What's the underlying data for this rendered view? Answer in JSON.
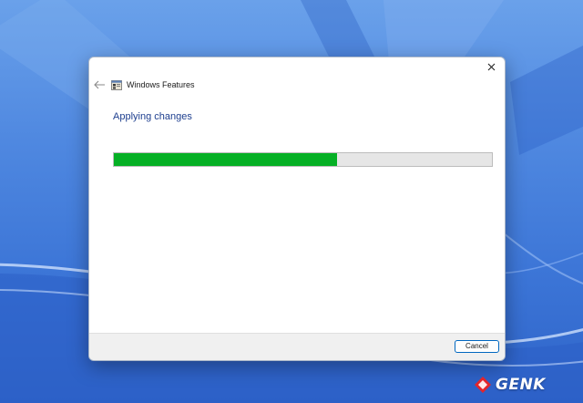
{
  "window": {
    "title": "Windows Features",
    "heading": "Applying changes"
  },
  "progress": {
    "fraction": 0.59,
    "fill_color": "#06b025",
    "track_color": "#e6e6e6"
  },
  "footer": {
    "cancel_label": "Cancel"
  },
  "watermark": {
    "text": "GENK",
    "accent_color": "#e4252b"
  },
  "icons": {
    "close": "close-icon",
    "back": "back-arrow-icon",
    "app": "windows-features-icon"
  }
}
